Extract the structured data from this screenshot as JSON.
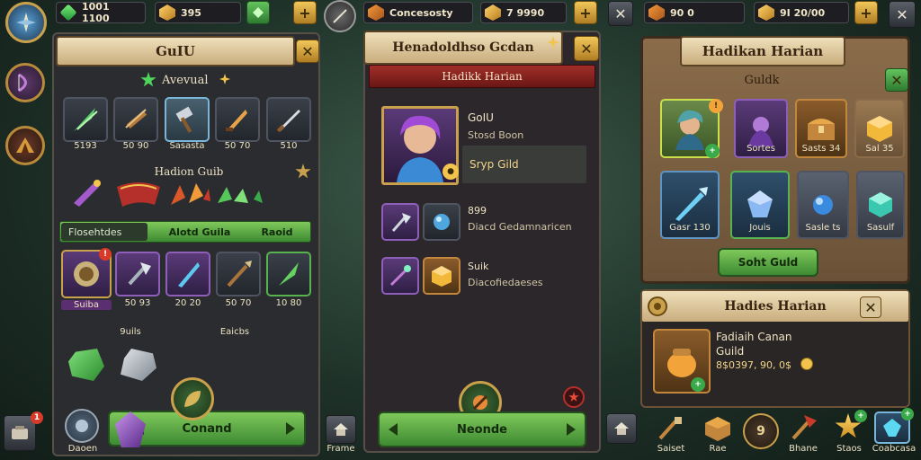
{
  "left": {
    "gem_value": "1001 1100",
    "gold_value": "395",
    "title": "GuIU",
    "subtitle": "Avevual",
    "row1_labels": [
      "5193",
      "50 90",
      "Sasasta",
      "50 70",
      "510"
    ],
    "section2_title": "Hadion Guib",
    "tab_left": "Flosehtdes",
    "tab_mid": "Alotd Guila",
    "tab_right": "Raoid",
    "row3_labels": [
      "Suiba",
      "50 93",
      "20 20",
      "50 70",
      "10 80"
    ],
    "row4_labels": [
      "9uils",
      "Eaicbs"
    ],
    "button_label": "Conand",
    "nav_label": "Daoen",
    "side_badge": "1"
  },
  "middle": {
    "resource1": "Concesosty",
    "gold_value": "7      9990",
    "title": "Henadoldhso Gcdan",
    "banner": "Hadikk Harian",
    "hero_name": "GoIU",
    "hero_line": "Stosd Boon",
    "hero_action": "Sryp Gild",
    "item1_title": "899",
    "item1_desc": "Diacd Gedamnaricen",
    "item2_title": "Suik",
    "item2_desc": "Diacofiedaeses",
    "button_label": "Neonde",
    "nav_label": "Frame"
  },
  "right": {
    "gem_value": "90         0",
    "gold_value": "9I      20/00",
    "title": "Hadikan Harian",
    "subtitle": "Guldk",
    "row1_labels": [
      "",
      "Sortes",
      "Sasts 34",
      "Sal 35"
    ],
    "row2_labels": [
      "Gasr 130",
      "Jouis",
      "Sasle ts",
      "Sasulf"
    ],
    "button_label": "Soht Guld",
    "panel2_title": "Hadies Harian",
    "panel2_name": "Fadiaih Canan",
    "panel2_sub": "Guild",
    "panel2_value": "8$0397, 90, 0$",
    "nav_labels": [
      "Saiset",
      "Rae",
      "9",
      "Bhane",
      "Staos",
      "Coabcasa"
    ]
  }
}
